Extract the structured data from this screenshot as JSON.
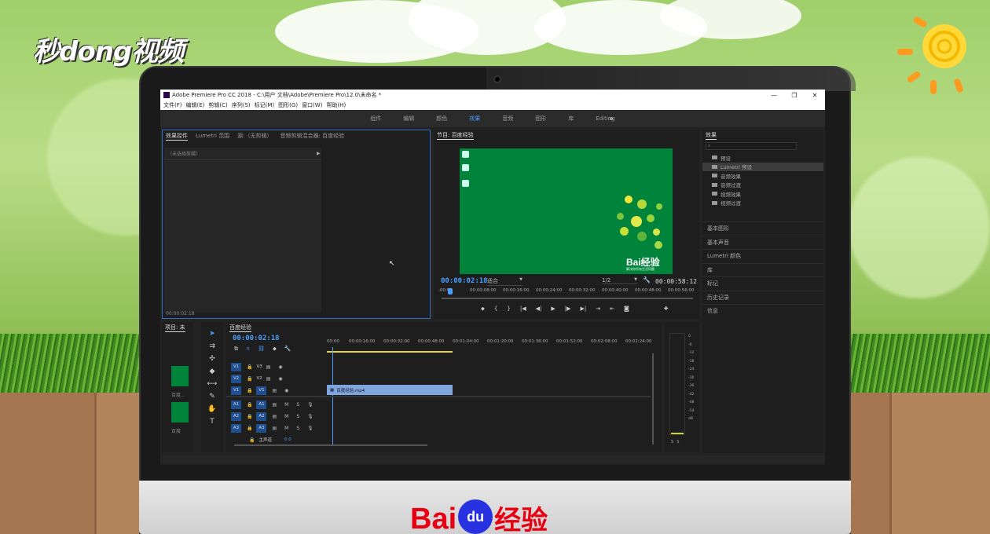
{
  "overlay": {
    "top_logo": "秒dong视频",
    "bottom_brand": {
      "bai": "Bai",
      "du": "du",
      "cn": "经验"
    }
  },
  "app": {
    "title": "Adobe Premiere Pro CC 2018 - C:\\用户        文档\\Adobe\\Premiere Pro\\12.0\\未命名 *",
    "menus": [
      "文件(F)",
      "编辑(E)",
      "剪辑(C)",
      "序列(S)",
      "标记(M)",
      "图形(G)",
      "窗口(W)",
      "帮助(H)"
    ],
    "window_controls": [
      "—",
      "❐",
      "✕"
    ],
    "workspaces": [
      "组件",
      "编辑",
      "颜色",
      "效果",
      "音频",
      "图形",
      "库",
      "Editing"
    ],
    "active_workspace": "效果",
    "workspace_more": "»"
  },
  "source_panel": {
    "tabs": [
      "效果控件",
      "Lumetri 范围",
      "源:（无剪辑）",
      "音频剪辑混合器: 百度经验"
    ],
    "no_clip": "（未选择剪辑）",
    "timecode": "00:00:02:18"
  },
  "program": {
    "title": "节目: 百度经验",
    "timecode": "00:00:02:18",
    "fit": "适合",
    "resolution": "1/2",
    "duration": "00:00:58:12",
    "ruler": [
      ":00:00",
      "00:00:08:00",
      "00:00:16:00",
      "00:00:24:00",
      "00:00:32:00",
      "00:00:40:00",
      "00:00:48:00",
      "00:00:56:00"
    ],
    "watermark": "Bai经验",
    "watermark_sub": "解决你所有生活问题"
  },
  "effects_panel": {
    "title": "效果",
    "items": [
      "预设",
      "Lumetri 预设",
      "音频效果",
      "音频过渡",
      "视频效果",
      "视频过渡"
    ],
    "sections": [
      "基本图形",
      "基本声音",
      "Lumetri 颜色",
      "库",
      "标记",
      "历史记录",
      "信息"
    ]
  },
  "project_panel": {
    "title": "项目: 未",
    "item1": "百度...",
    "item2": "百度"
  },
  "timeline": {
    "title": "百度经验",
    "timecode": "00:00:02:18",
    "ruler": [
      "00:00",
      "00:00:16:00",
      "00:00:32:00",
      "00:00:48:00",
      "00:01:04:00",
      "00:01:20:00",
      "00:01:36:00",
      "00:01:52:00",
      "00:02:08:00",
      "00:02:24:00"
    ],
    "video_tracks": [
      "V3",
      "V2",
      "V1"
    ],
    "audio_tracks": [
      "A1",
      "A2",
      "A3"
    ],
    "master": "主声道",
    "master_value": "0.0",
    "clip": "百度经验.mp4"
  },
  "meter": {
    "labels": [
      "0",
      "-6",
      "-12",
      "-18",
      "-24",
      "-30",
      "-36",
      "-42",
      "-48",
      "-54",
      "dB"
    ],
    "solo": [
      "S",
      "S"
    ]
  }
}
